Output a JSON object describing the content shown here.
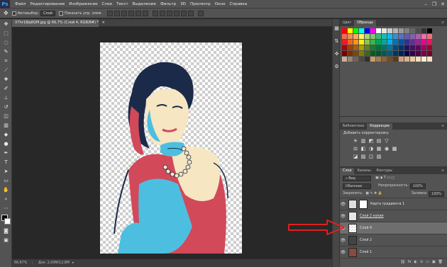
{
  "menubar": {
    "logo": "Ps",
    "items": [
      "Файл",
      "Редактирование",
      "Изображение",
      "Слои",
      "Текст",
      "Выделение",
      "Фильтр",
      "3D",
      "Просмотр",
      "Окно",
      "Справка"
    ],
    "window_controls": [
      "–",
      "❐",
      "✕"
    ]
  },
  "optionsbar": {
    "autoselect_label": "Автовыбор:",
    "autoselect_value": "Слой",
    "show_controls_label": "Показать упр. элем."
  },
  "document": {
    "tab_title": "X7hr18Jq6QM.jpg @ 66,7% (Слой 4, RGB/8#) *",
    "close": "×",
    "zoom": "66,67%",
    "doc_size": "Док: 2,00M/12,8M"
  },
  "swatches_panel": {
    "tabs": [
      "Цвет",
      "Образцы"
    ],
    "active_tab": "Образцы",
    "colors": [
      "#ff0000",
      "#ffff00",
      "#00ff00",
      "#00ffff",
      "#0000ff",
      "#ff00ff",
      "#ffffff",
      "#e6e6e6",
      "#cccccc",
      "#b3b3b3",
      "#999999",
      "#808080",
      "#666666",
      "#4d4d4d",
      "#333333",
      "#000000",
      "#f26c4f",
      "#f68e55",
      "#fbaf5c",
      "#fff467",
      "#acd372",
      "#7cc576",
      "#3bb878",
      "#1abbb4",
      "#00bff3",
      "#438ccb",
      "#5574b9",
      "#605ca8",
      "#855fa8",
      "#a763a8",
      "#f06ea9",
      "#f26d7d",
      "#ed1c24",
      "#f26522",
      "#f7941d",
      "#fff200",
      "#8dc63f",
      "#39b54a",
      "#00a651",
      "#00a99d",
      "#00aeef",
      "#0072bc",
      "#0054a6",
      "#2e3192",
      "#662d91",
      "#92278f",
      "#ec008c",
      "#ed145b",
      "#9e0b0f",
      "#a0410d",
      "#a3620a",
      "#aba000",
      "#598527",
      "#197b30",
      "#007236",
      "#00746b",
      "#0076a3",
      "#004a80",
      "#003471",
      "#1b1464",
      "#440e62",
      "#630460",
      "#9e005d",
      "#9e0039",
      "#790000",
      "#7b2e00",
      "#7d4900",
      "#827b00",
      "#406618",
      "#005e20",
      "#005826",
      "#005952",
      "#005b7f",
      "#003663",
      "#002157",
      "#0d004c",
      "#32004b",
      "#4b0049",
      "#7b0046",
      "#7a0026",
      "#c7b299",
      "#998675",
      "#736357",
      "#534741",
      "#37302a",
      "#c69c6d",
      "#a67c52",
      "#8c6239",
      "#754c24",
      "#603913",
      "#cfa080",
      "#d9b38c",
      "#e6cca0",
      "#f2ddb8",
      "#ffeed5",
      "#fbe1c3"
    ]
  },
  "libraries_panel": {
    "tabs": [
      "Библиотеки",
      "Коррекция"
    ],
    "active_tab": "Коррекция",
    "heading": "Добавить корректировку",
    "row1": [
      "☀",
      "▥",
      "◩",
      "▤",
      "▽"
    ],
    "row2": [
      "⚖",
      "◧",
      "◑",
      "▦",
      "◉",
      "▩"
    ],
    "row3": [
      "◪",
      "▨",
      "◫",
      "▧"
    ]
  },
  "layers_panel": {
    "tabs": [
      "Слои",
      "Каналы",
      "Контуры"
    ],
    "active_tab": "Слои",
    "kind_label": "Вид",
    "blend_mode": "Обычные",
    "opacity_label": "Непрозрачность:",
    "opacity_value": "100%",
    "lock_label": "Закрепить:",
    "fill_label": "Заливка:",
    "fill_value": "100%",
    "layers": [
      {
        "name": "Карта градиента 1",
        "visible": true,
        "selected": false
      },
      {
        "name": "Слой 2 копия",
        "visible": true,
        "selected": false
      },
      {
        "name": "Слой 4",
        "visible": true,
        "selected": true
      },
      {
        "name": "Слой 2",
        "visible": true,
        "selected": false
      },
      {
        "name": "Слой 1",
        "visible": true,
        "selected": false
      }
    ],
    "footer_icons": [
      "⛓",
      "fx",
      "◐",
      "⊙",
      "▭",
      "▣",
      "🗑"
    ]
  },
  "colors": {
    "poster_red": "#d2495a",
    "poster_blue": "#4cbfe0",
    "poster_cream": "#f6e6c2",
    "poster_navy": "#1b2a48",
    "arrow_red": "#e02020"
  }
}
